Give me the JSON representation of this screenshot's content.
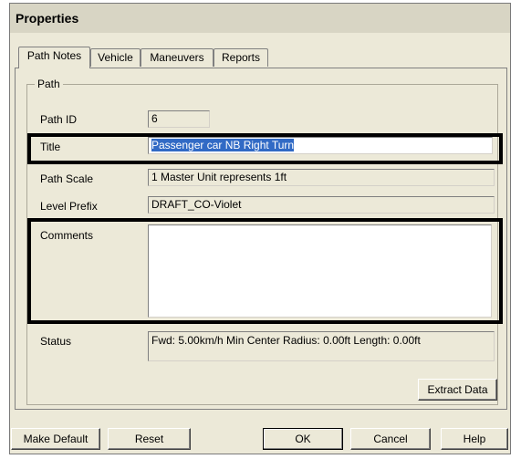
{
  "window": {
    "title": "Properties"
  },
  "tabs": [
    {
      "label": "Path Notes",
      "active": true
    },
    {
      "label": "Vehicle"
    },
    {
      "label": "Maneuvers"
    },
    {
      "label": "Reports"
    }
  ],
  "group": {
    "label": "Path"
  },
  "fields": {
    "path_id": {
      "label": "Path ID",
      "value": "6"
    },
    "title": {
      "label": "Title",
      "value": "Passenger car NB Right Turn"
    },
    "path_scale": {
      "label": "Path Scale",
      "value": "1 Master Unit represents 1ft"
    },
    "level_prefix": {
      "label": "Level Prefix",
      "value": "DRAFT_CO-Violet"
    },
    "comments": {
      "label": "Comments",
      "value": ""
    },
    "status": {
      "label": "Status",
      "value": "Fwd: 5.00km/h Min Center Radius: 0.00ft Length: 0.00ft"
    }
  },
  "buttons": {
    "extract_data": "Extract Data",
    "make_default": "Make Default",
    "reset": "Reset",
    "ok": "OK",
    "cancel": "Cancel",
    "help": "Help"
  }
}
